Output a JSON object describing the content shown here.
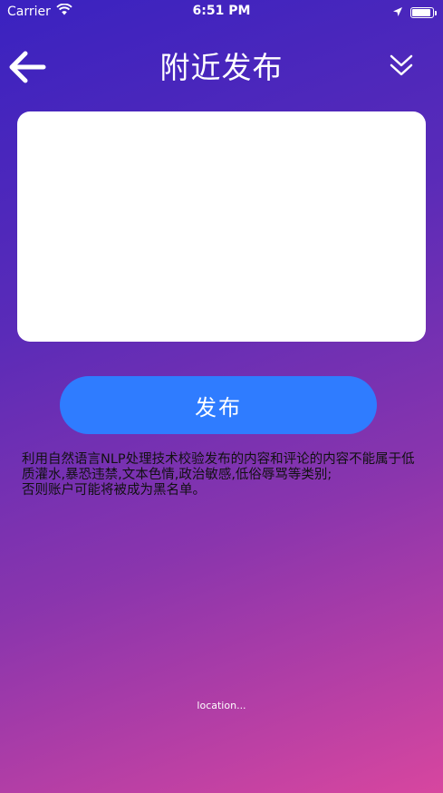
{
  "status_bar": {
    "carrier": "Carrier",
    "time": "6:51 PM",
    "battery_level": 0.9
  },
  "nav": {
    "title": "附近发布"
  },
  "post": {
    "placeholder": "",
    "value": ""
  },
  "publish_label": "发布",
  "notice": {
    "line1": "利用自然语言NLP处理技术校验发布的内容和评论的内容不能属于低质灌水,暴恐违禁,文本色情,政治敏感,低俗辱骂等类别;",
    "line2": "否则账户可能将被成为黑名单。"
  },
  "location_text": "location..."
}
